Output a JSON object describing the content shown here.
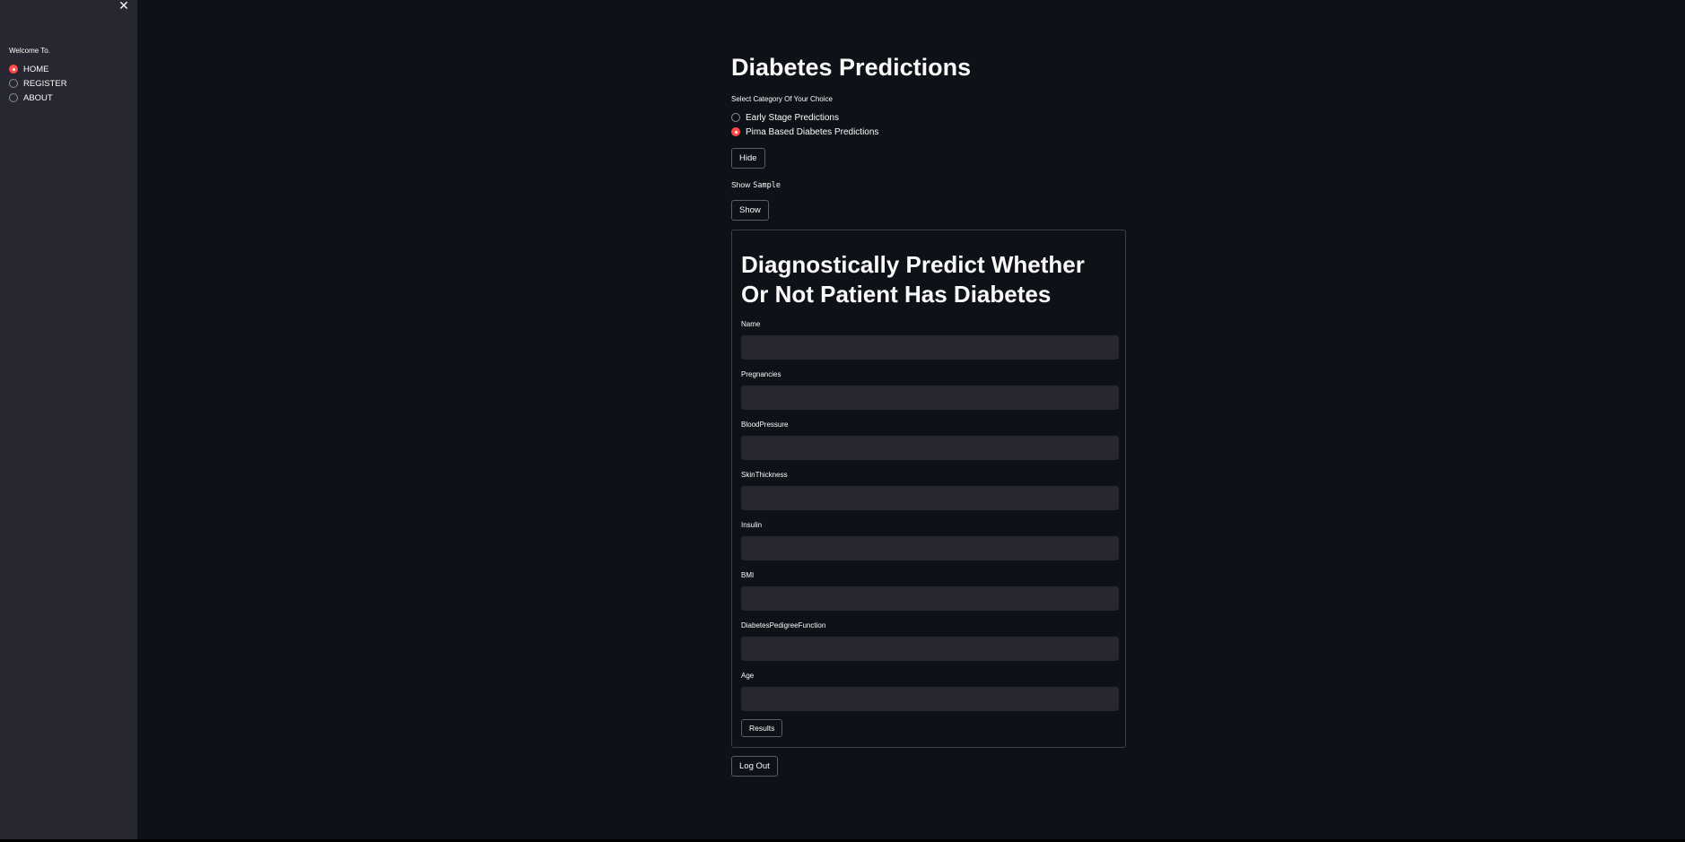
{
  "sidebar": {
    "close_icon": "close-icon",
    "label": "Welcome To.",
    "items": [
      {
        "label": "HOME",
        "selected": true
      },
      {
        "label": "REGISTER",
        "selected": false
      },
      {
        "label": "ABOUT",
        "selected": false
      }
    ]
  },
  "main": {
    "title": "Diabetes Predictions",
    "select_label": "Select Category Of Your Choice",
    "options": [
      {
        "label": "Early Stage Predictions",
        "selected": false
      },
      {
        "label": "Pima Based Diabetes Predictions",
        "selected": true
      }
    ],
    "hide_label": "Hide",
    "show_sample_text": "Show",
    "show_sample_code": "Sample",
    "show_label": "Show",
    "logout_label": "Log Out"
  },
  "form": {
    "title": "Diagnostically Predict Whether Or Not Patient Has Diabetes",
    "fields": [
      {
        "label": "Name",
        "value": ""
      },
      {
        "label": "Pregnancies",
        "value": ""
      },
      {
        "label": "BloodPressure",
        "value": ""
      },
      {
        "label": "SkinThickness",
        "value": ""
      },
      {
        "label": "Insulin",
        "value": ""
      },
      {
        "label": "BMI",
        "value": ""
      },
      {
        "label": "DiabetesPedigreeFunction",
        "value": ""
      },
      {
        "label": "Age",
        "value": ""
      }
    ],
    "results_label": "Results"
  },
  "colors": {
    "background": "#0e1117",
    "sidebar": "#262730",
    "accent": "#ff4b4b"
  }
}
